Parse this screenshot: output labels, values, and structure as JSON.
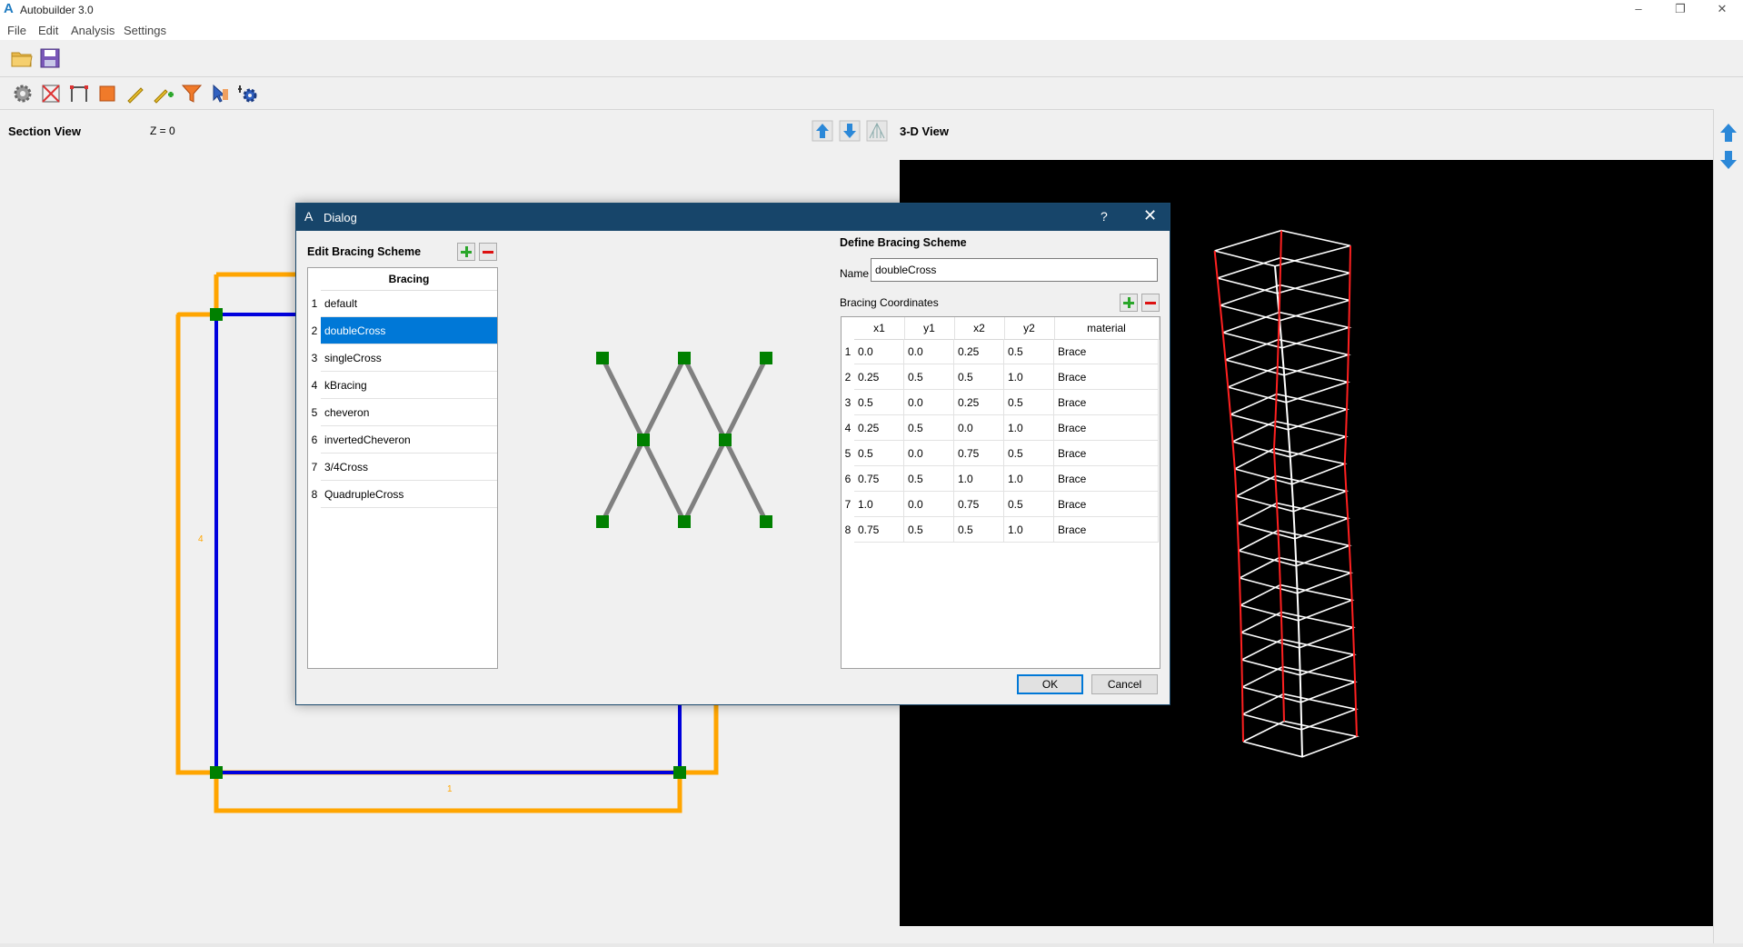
{
  "window": {
    "title": "Autobuilder 3.0",
    "logo": "A",
    "controls": [
      "–",
      "❐",
      "✕"
    ]
  },
  "menu": [
    "File",
    "Edit",
    "Analysis",
    "Settings"
  ],
  "toolbar1": [
    {
      "icon": "open-folder-icon"
    },
    {
      "icon": "save-disk-icon"
    }
  ],
  "toolbar2": [
    {
      "icon": "gear-icon"
    },
    {
      "icon": "bracing-icon"
    },
    {
      "icon": "frame-icon"
    },
    {
      "icon": "panel-icon"
    },
    {
      "icon": "pencil-icon"
    },
    {
      "icon": "add-pencil-icon"
    },
    {
      "icon": "filter-icon"
    },
    {
      "icon": "cursor-hand-icon"
    },
    {
      "icon": "settings-cog-icon"
    }
  ],
  "section_view": {
    "title": "Section View",
    "z_label": "Z = 0",
    "labels": {
      "left": "4",
      "bottom": "1"
    }
  },
  "view3d": {
    "title": "3-D View"
  },
  "dialog": {
    "title": "Dialog",
    "help": "?",
    "close": "✕",
    "edit_title": "Edit Bracing Scheme",
    "list_header": "Bracing",
    "bracing_items": [
      {
        "num": "1",
        "name": "default"
      },
      {
        "num": "2",
        "name": "doubleCross"
      },
      {
        "num": "3",
        "name": "singleCross"
      },
      {
        "num": "4",
        "name": "kBracing"
      },
      {
        "num": "5",
        "name": "cheveron"
      },
      {
        "num": "6",
        "name": "invertedCheveron"
      },
      {
        "num": "7",
        "name": "3/4Cross"
      },
      {
        "num": "8",
        "name": "QuadrupleCross"
      }
    ],
    "selected_index": 1,
    "define_title": "Define Bracing Scheme",
    "name_label": "Name",
    "name_value": "doubleCross",
    "coords_title": "Bracing Coordinates",
    "columns": [
      "x1",
      "y1",
      "x2",
      "y2",
      "material"
    ],
    "rows": [
      {
        "num": "1",
        "x1": "0.0",
        "y1": "0.0",
        "x2": "0.25",
        "y2": "0.5",
        "material": "Brace"
      },
      {
        "num": "2",
        "x1": "0.25",
        "y1": "0.5",
        "x2": "0.5",
        "y2": "1.0",
        "material": "Brace"
      },
      {
        "num": "3",
        "x1": "0.5",
        "y1": "0.0",
        "x2": "0.25",
        "y2": "0.5",
        "material": "Brace"
      },
      {
        "num": "4",
        "x1": "0.25",
        "y1": "0.5",
        "x2": "0.0",
        "y2": "1.0",
        "material": "Brace"
      },
      {
        "num": "5",
        "x1": "0.5",
        "y1": "0.0",
        "x2": "0.75",
        "y2": "0.5",
        "material": "Brace"
      },
      {
        "num": "6",
        "x1": "0.75",
        "y1": "0.5",
        "x2": "1.0",
        "y2": "1.0",
        "material": "Brace"
      },
      {
        "num": "7",
        "x1": "1.0",
        "y1": "0.0",
        "x2": "0.75",
        "y2": "0.5",
        "material": "Brace"
      },
      {
        "num": "8",
        "x1": "0.75",
        "y1": "0.5",
        "x2": "0.5",
        "y2": "1.0",
        "material": "Brace"
      }
    ],
    "ok_label": "OK",
    "cancel_label": "Cancel"
  },
  "colors": {
    "dialog_title_bg": "#17456a",
    "selection": "#0078d7",
    "frame_blue": "#0000dd",
    "frame_orange": "#ffa500",
    "node_green": "#008000",
    "tower_red": "#ff2020"
  }
}
